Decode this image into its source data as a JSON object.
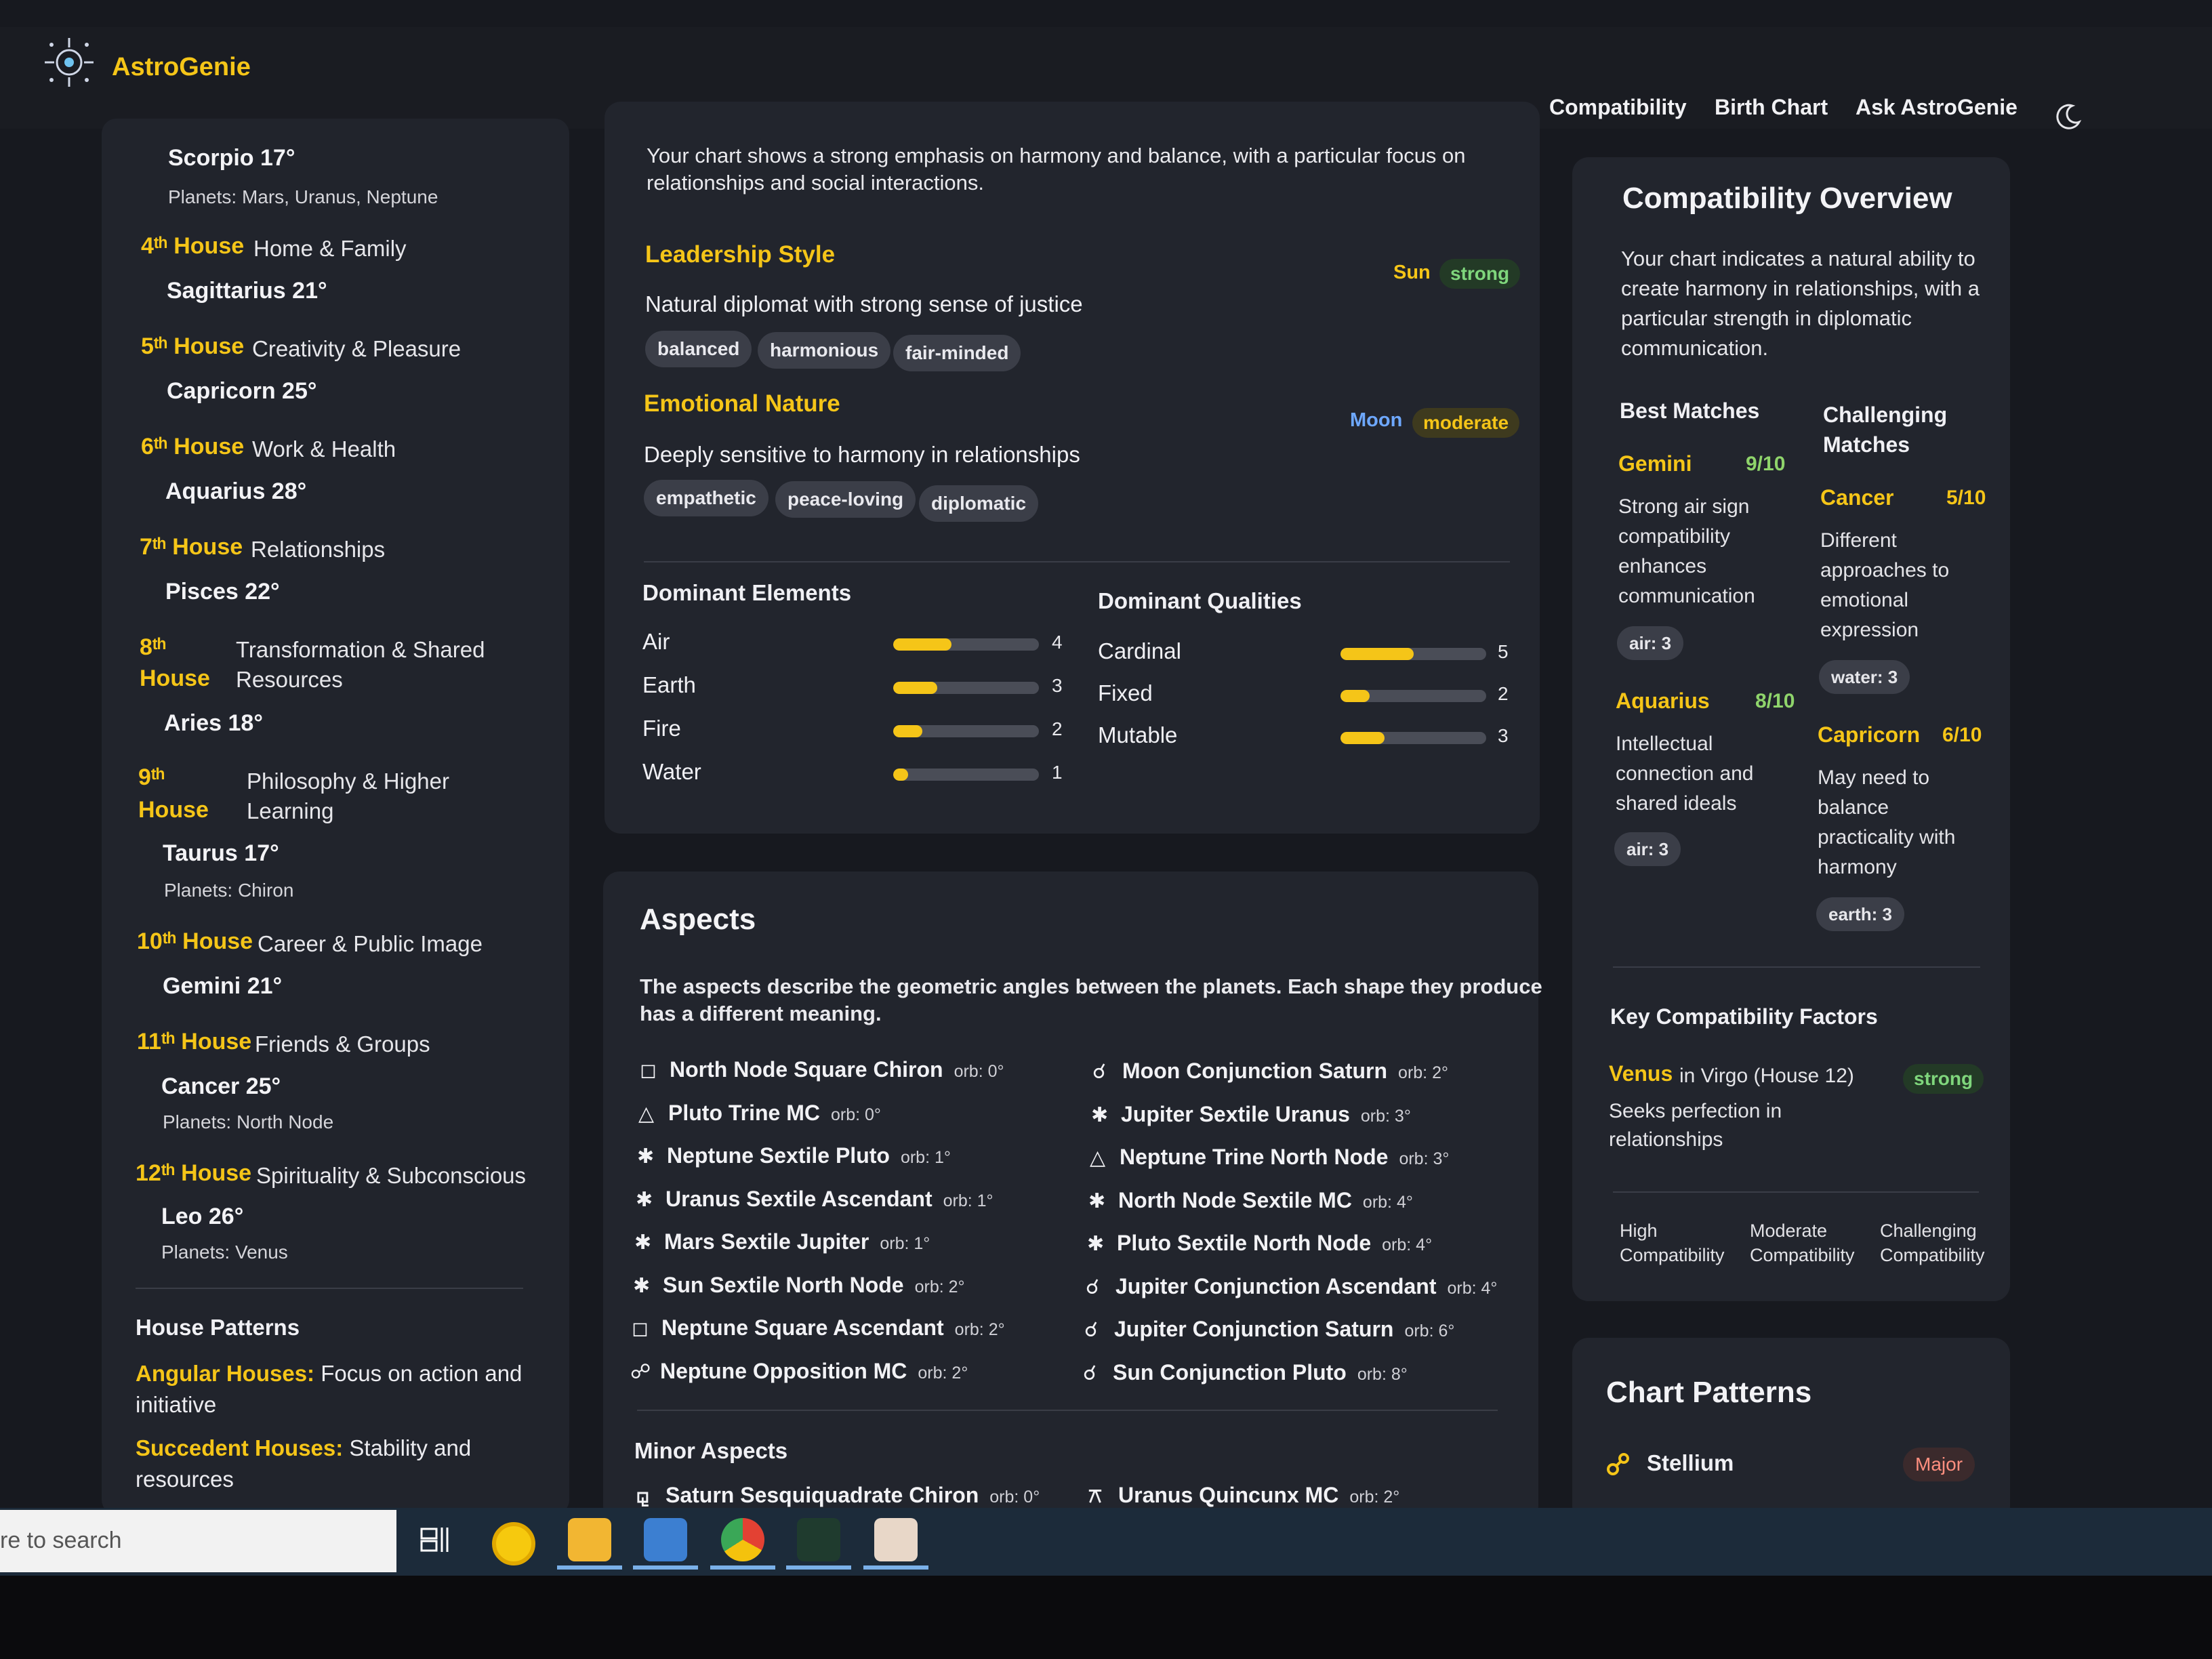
{
  "header": {
    "brand": "AstroGenie",
    "nav": [
      "Compatibility",
      "Birth Chart",
      "Ask AstroGenie"
    ],
    "accent": "#f5c518"
  },
  "sidebar": {
    "top_fragment": {
      "sign": "Scorpio 17°",
      "planets": "Planets: Mars, Uranus, Neptune"
    },
    "houses": [
      {
        "num": "4ᵗʰ House",
        "desc": "Home & Family",
        "sign": "Sagittarius 21°"
      },
      {
        "num": "5ᵗʰ House",
        "desc": "Creativity & Pleasure",
        "sign": "Capricorn 25°"
      },
      {
        "num": "6ᵗʰ House",
        "desc": "Work & Health",
        "sign": "Aquarius 28°"
      },
      {
        "num": "7ᵗʰ House",
        "desc": "Relationships",
        "sign": "Pisces 22°"
      },
      {
        "num1": "8ᵗʰ",
        "num2": "House",
        "desc1": "Transformation & Shared",
        "desc2": "Resources",
        "sign": "Aries 18°"
      },
      {
        "num1": "9ᵗʰ",
        "num2": "House",
        "desc1": "Philosophy & Higher",
        "desc2": "Learning",
        "sign": "Taurus 17°",
        "planets": "Planets: Chiron"
      },
      {
        "num": "10ᵗʰ House",
        "desc": "Career & Public Image",
        "sign": "Gemini 21°"
      },
      {
        "num": "11ᵗʰ House",
        "desc": "Friends & Groups",
        "sign": "Cancer 25°",
        "planets": "Planets: North Node"
      },
      {
        "num": "12ᵗʰ House",
        "desc": "Spirituality & Subconscious",
        "sign": "Leo 26°",
        "planets": "Planets: Venus"
      }
    ],
    "patterns_title": "House Patterns",
    "patterns": [
      {
        "label": "Angular Houses:",
        "line1": " Focus on action and",
        "line2": "initiative"
      },
      {
        "label": "Succedent Houses:",
        "line1": " Stability and",
        "line2": "resources"
      }
    ]
  },
  "summary": {
    "intro1": "Your chart shows a strong emphasis on harmony and balance, with a particular focus on",
    "intro2": "relationships and social interactions.",
    "traits": [
      {
        "title": "Leadership Style",
        "desc": "Natural diplomat with strong sense of justice",
        "planet": "Sun",
        "strength": "strong",
        "chips": [
          "balanced",
          "harmonious",
          "fair-minded"
        ]
      },
      {
        "title": "Emotional Nature",
        "desc": "Deeply sensitive to harmony in relationships",
        "planet": "Moon",
        "strength": "moderate",
        "chips": [
          "empathetic",
          "peace-loving",
          "diplomatic"
        ]
      }
    ],
    "elements_title": "Dominant Elements",
    "elements": [
      {
        "name": "Air",
        "value": 4
      },
      {
        "name": "Earth",
        "value": 3
      },
      {
        "name": "Fire",
        "value": 2
      },
      {
        "name": "Water",
        "value": 1
      }
    ],
    "qualities_title": "Dominant Qualities",
    "qualities": [
      {
        "name": "Cardinal",
        "value": 5
      },
      {
        "name": "Fixed",
        "value": 2
      },
      {
        "name": "Mutable",
        "value": 3
      }
    ],
    "bar_max": 10,
    "colors": {
      "sun": "#f5c518",
      "moon": "#6ea8ff",
      "strong": "#7fd67c"
    }
  },
  "aspects": {
    "title": "Aspects",
    "desc1": "The aspects describe the geometric angles between the planets. Each shape they produce",
    "desc2": "has a different meaning.",
    "left": [
      {
        "sym": "◻",
        "text": "North Node Square Chiron",
        "orb": "orb: 0°"
      },
      {
        "sym": "△",
        "text": "Pluto Trine MC",
        "orb": "orb: 0°"
      },
      {
        "sym": "✱",
        "text": "Neptune Sextile Pluto",
        "orb": "orb: 1°"
      },
      {
        "sym": "✱",
        "text": "Uranus Sextile Ascendant",
        "orb": "orb: 1°"
      },
      {
        "sym": "✱",
        "text": "Mars Sextile Jupiter",
        "orb": "orb: 1°"
      },
      {
        "sym": "✱",
        "text": "Sun Sextile North Node",
        "orb": "orb: 2°"
      },
      {
        "sym": "◻",
        "text": "Neptune Square Ascendant",
        "orb": "orb: 2°"
      },
      {
        "sym": "☍",
        "text": "Neptune Opposition MC",
        "orb": "orb: 2°"
      }
    ],
    "right": [
      {
        "sym": "☌",
        "text": "Moon Conjunction Saturn",
        "orb": "orb: 2°"
      },
      {
        "sym": "✱",
        "text": "Jupiter Sextile Uranus",
        "orb": "orb: 3°"
      },
      {
        "sym": "△",
        "text": "Neptune Trine North Node",
        "orb": "orb: 3°"
      },
      {
        "sym": "✱",
        "text": "North Node Sextile MC",
        "orb": "orb: 4°"
      },
      {
        "sym": "✱",
        "text": "Pluto Sextile North Node",
        "orb": "orb: 4°"
      },
      {
        "sym": "☌",
        "text": "Jupiter Conjunction Ascendant",
        "orb": "orb: 4°"
      },
      {
        "sym": "☌",
        "text": "Jupiter Conjunction Saturn",
        "orb": "orb: 6°"
      },
      {
        "sym": "☌",
        "text": "Sun Conjunction Pluto",
        "orb": "orb: 8°"
      }
    ],
    "minor_title": "Minor Aspects",
    "minor": [
      {
        "sym": "⚼",
        "text": "Saturn Sesquiquadrate Chiron",
        "orb": "orb: 0°"
      },
      {
        "sym": "⚻",
        "text": "Uranus Quincunx MC",
        "orb": "orb: 2°"
      }
    ]
  },
  "compat": {
    "title": "Compatibility Overview",
    "desc": [
      "Your chart indicates a natural ability to",
      "create harmony in relationships, with a",
      "particular strength in diplomatic",
      "communication."
    ],
    "best_title": "Best Matches",
    "challenging_title1": "Challenging",
    "challenging_title2": "Matches",
    "best": [
      {
        "sign": "Gemini",
        "score": "9/10",
        "desc": [
          "Strong air sign",
          "compatibility",
          "enhances",
          "communication"
        ],
        "chip": "air: 3"
      },
      {
        "sign": "Aquarius",
        "score": "8/10",
        "desc": [
          "Intellectual",
          "connection and",
          "shared ideals"
        ],
        "chip": "air: 3"
      }
    ],
    "challenging": [
      {
        "sign": "Cancer",
        "score": "5/10",
        "desc": [
          "Different",
          "approaches to",
          "emotional",
          "expression"
        ],
        "chip": "water: 3"
      },
      {
        "sign": "Capricorn",
        "score": "6/10",
        "desc": [
          "May need to",
          "balance",
          "practicality with",
          "harmony"
        ],
        "chip": "earth: 3"
      }
    ],
    "factors_title": "Key Compatibility Factors",
    "factor": {
      "planet": "Venus",
      "where": "in Virgo (House 12)",
      "strength": "strong",
      "desc1": "Seeks perfection in",
      "desc2": "relationships"
    },
    "legend": [
      [
        "High",
        "Compatibility"
      ],
      [
        "Moderate",
        "Compatibility"
      ],
      [
        "Challenging",
        "Compatibility"
      ]
    ]
  },
  "patterns": {
    "title": "Chart Patterns",
    "item": "Stellium",
    "badge": "Major"
  },
  "taskbar": {
    "search_text": "re to search"
  }
}
